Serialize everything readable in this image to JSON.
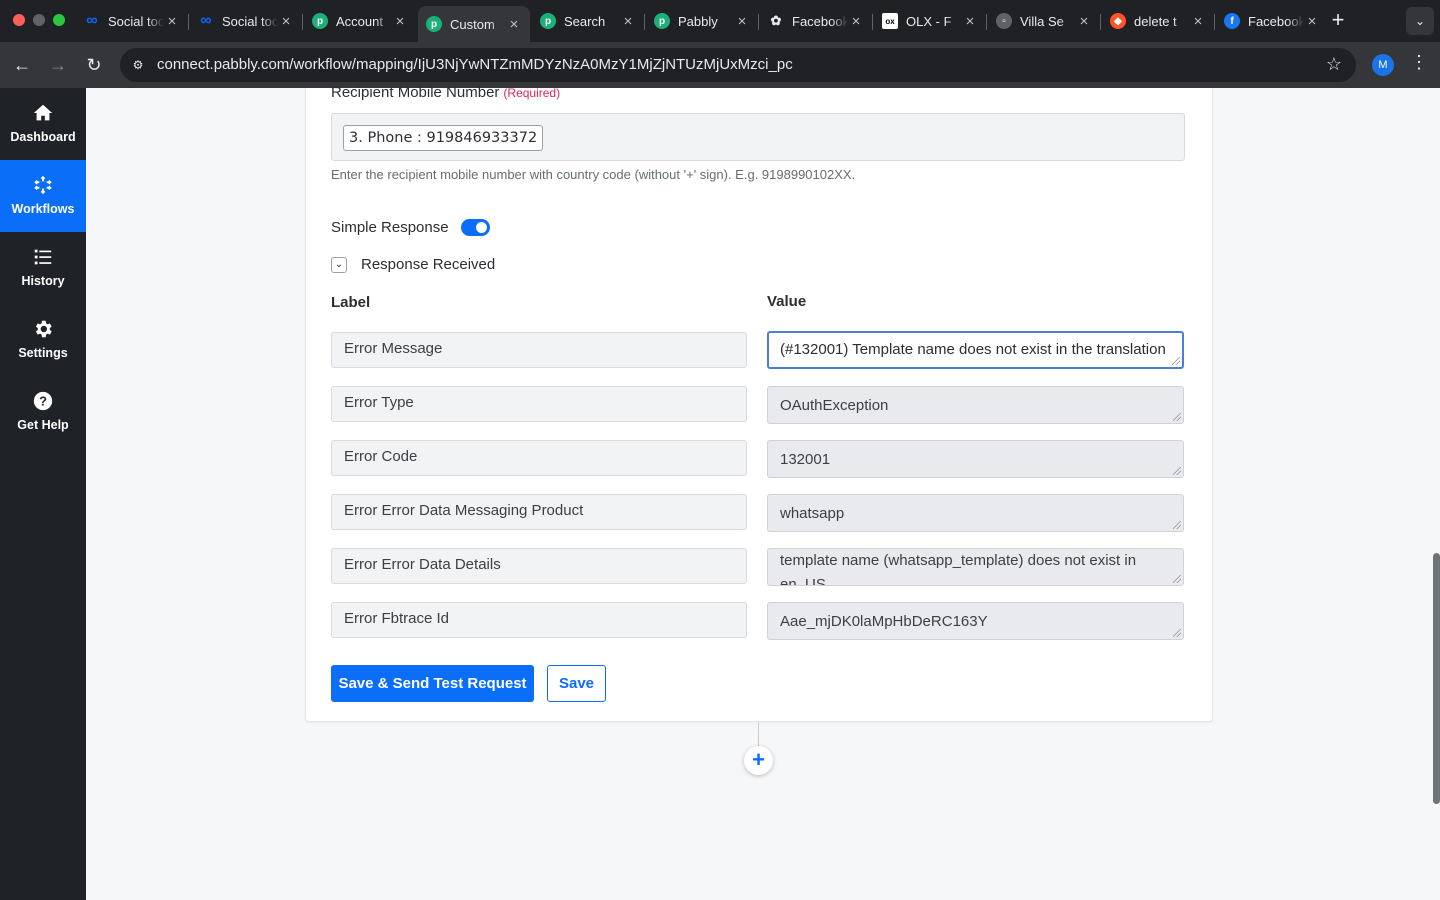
{
  "browser": {
    "tabs": [
      {
        "title": "Social tools",
        "icon": "meta-icon",
        "color": "#0866ff"
      },
      {
        "title": "Social tools",
        "icon": "meta-icon",
        "color": "#0866ff"
      },
      {
        "title": "Account",
        "icon": "pabbly-icon",
        "color": "#1bb07a"
      },
      {
        "title": "Custom",
        "icon": "pabbly-icon",
        "color": "#1bb07a",
        "active": true
      },
      {
        "title": "Search",
        "icon": "pabbly-icon",
        "color": "#1bb07a"
      },
      {
        "title": "Pabbly",
        "icon": "pabbly-icon",
        "color": "#1bb07a"
      },
      {
        "title": "Facebook",
        "icon": "openai-icon",
        "color": "#202124"
      },
      {
        "title": "OLX - F",
        "icon": "olx-icon",
        "color": "#ffffff"
      },
      {
        "title": "Villa Se",
        "icon": "page-icon",
        "color": "#5f6368"
      },
      {
        "title": "delete t",
        "icon": "brave-icon",
        "color": "#fb542b"
      },
      {
        "title": "Facebook",
        "icon": "facebook-icon",
        "color": "#1877f2"
      }
    ],
    "url": "connect.pabbly.com/workflow/mapping/IjU3NjYwNTZmMDYzNzA0MzY1MjZjNTUzMjUxMzci_pc",
    "profile_initial": "M"
  },
  "sidebar": {
    "items": [
      {
        "label": "Dashboard",
        "icon": "home-icon"
      },
      {
        "label": "Workflows",
        "icon": "workflow-icon",
        "active": true
      },
      {
        "label": "History",
        "icon": "history-list-icon"
      },
      {
        "label": "Settings",
        "icon": "gear-icon"
      },
      {
        "label": "Get Help",
        "icon": "help-icon"
      }
    ]
  },
  "form": {
    "mobile_label": "Recipient Mobile Number",
    "required_tag": "(Required)",
    "mobile_chip": "3. Phone : 919846933372",
    "mobile_help": "Enter the recipient mobile number with country code (without '+' sign). E.g. 9198990102XX.",
    "simple_response_label": "Simple Response",
    "simple_response_on": true,
    "response_received_label": "Response Received",
    "label_header": "Label",
    "value_header": "Value",
    "rows": [
      {
        "label": "Error Message",
        "value": "(#132001) Template name does not exist in the translation"
      },
      {
        "label": "Error Type",
        "value": "OAuthException"
      },
      {
        "label": "Error Code",
        "value": "132001"
      },
      {
        "label": "Error Error Data Messaging Product",
        "value": "whatsapp"
      },
      {
        "label": "Error Error Data Details",
        "value": "template name (whatsapp_template) does not exist in en_US"
      },
      {
        "label": "Error Fbtrace Id",
        "value": "Aae_mjDK0laMpHbDeRC163Y"
      }
    ],
    "save_send_label": "Save & Send Test Request",
    "save_label": "Save"
  },
  "colors": {
    "accent": "#0b6ef9",
    "sidebar_bg": "#1f2328",
    "required": "#e0245e"
  }
}
